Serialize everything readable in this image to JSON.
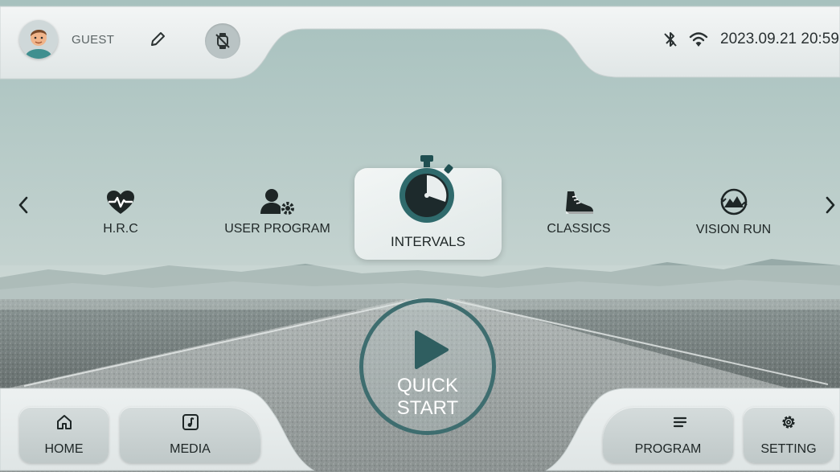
{
  "header": {
    "username": "GUEST",
    "datetime": "2023.09.21 20:59",
    "icons": [
      "avatar",
      "edit-icon",
      "watch-disconnected-icon",
      "bluetooth-off-icon",
      "wifi-icon"
    ]
  },
  "programs": {
    "items": [
      {
        "label": "H.R.C",
        "icon": "heart-rate-icon"
      },
      {
        "label": "USER PROGRAM",
        "icon": "user-settings-icon"
      },
      {
        "label": "INTERVALS",
        "icon": "stopwatch-icon",
        "selected": true
      },
      {
        "label": "CLASSICS",
        "icon": "shoe-icon"
      },
      {
        "label": "VISION RUN",
        "icon": "landscape-icon"
      }
    ]
  },
  "quick_start": {
    "line1": "QUICK",
    "line2": "START"
  },
  "bottom_nav": {
    "home": "HOME",
    "media": "MEDIA",
    "program": "PROGRAM",
    "setting": "SETTING"
  },
  "colors": {
    "accent": "#2f5e60",
    "panel": "#e9eeee",
    "sky": "#a9c2bf"
  }
}
